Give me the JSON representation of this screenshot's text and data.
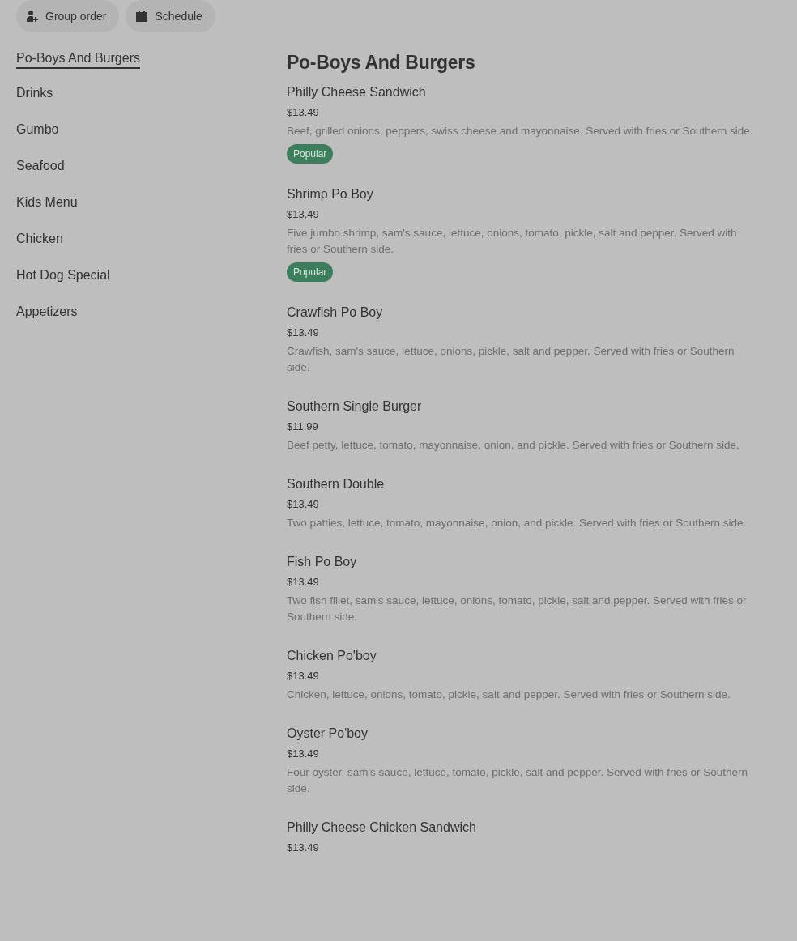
{
  "top_buttons": [
    {
      "label": "Group order",
      "kind": "group"
    },
    {
      "label": "Schedule",
      "kind": "schedule"
    }
  ],
  "categories": [
    {
      "label": "Po-Boys And Burgers",
      "selected": true
    },
    {
      "label": "Drinks",
      "selected": false
    },
    {
      "label": "Gumbo",
      "selected": false
    },
    {
      "label": "Seafood",
      "selected": false
    },
    {
      "label": "Kids Menu",
      "selected": false
    },
    {
      "label": "Chicken",
      "selected": false
    },
    {
      "label": "Hot Dog Special",
      "selected": false
    },
    {
      "label": "Appetizers",
      "selected": false
    }
  ],
  "section_title": "Po-Boys And Burgers",
  "items": [
    {
      "name": "Philly Cheese Sandwich",
      "price": "$13.49",
      "description": "Beef, grilled onions, peppers, swiss cheese and mayonnaise. Served with fries or Southern side.",
      "badge": "Popular"
    },
    {
      "name": "Shrimp Po Boy",
      "price": "$13.49",
      "description": "Five jumbo shrimp, sam's sauce, lettuce, onions, tomato, pickle, salt and pepper. Served with fries or Southern side.",
      "badge": "Popular"
    },
    {
      "name": "Crawfish Po Boy",
      "price": "$13.49",
      "description": "Crawfish, sam's sauce, lettuce, onions, pickle, salt and pepper. Served with fries or Southern side."
    },
    {
      "name": "Southern Single Burger",
      "price": "$11.99",
      "description": "Beef petty, lettuce, tomato, mayonnaise, onion, and pickle. Served with fries or Southern side."
    },
    {
      "name": "Southern Double",
      "price": "$13.49",
      "description": "Two patties, lettuce, tomato, mayonnaise, onion, and pickle. Served with fries or Southern side."
    },
    {
      "name": "Fish Po Boy",
      "price": "$13.49",
      "description": "Two fish fillet, sam's sauce, lettuce, onions, tomato, pickle, salt and pepper. Served with fries or Southern side."
    },
    {
      "name": "Chicken Po'boy",
      "price": "$13.49",
      "description": "Chicken, lettuce, onions, tomato, pickle, salt and pepper. Served with fries or Southern side."
    },
    {
      "name": "Oyster Po'boy",
      "price": "$13.49",
      "description": "Four oyster, sam's sauce, lettuce, tomato, pickle, salt and pepper. Served with fries or Southern side."
    },
    {
      "name": "Philly Cheese Chicken Sandwich",
      "price": "$13.49"
    }
  ]
}
